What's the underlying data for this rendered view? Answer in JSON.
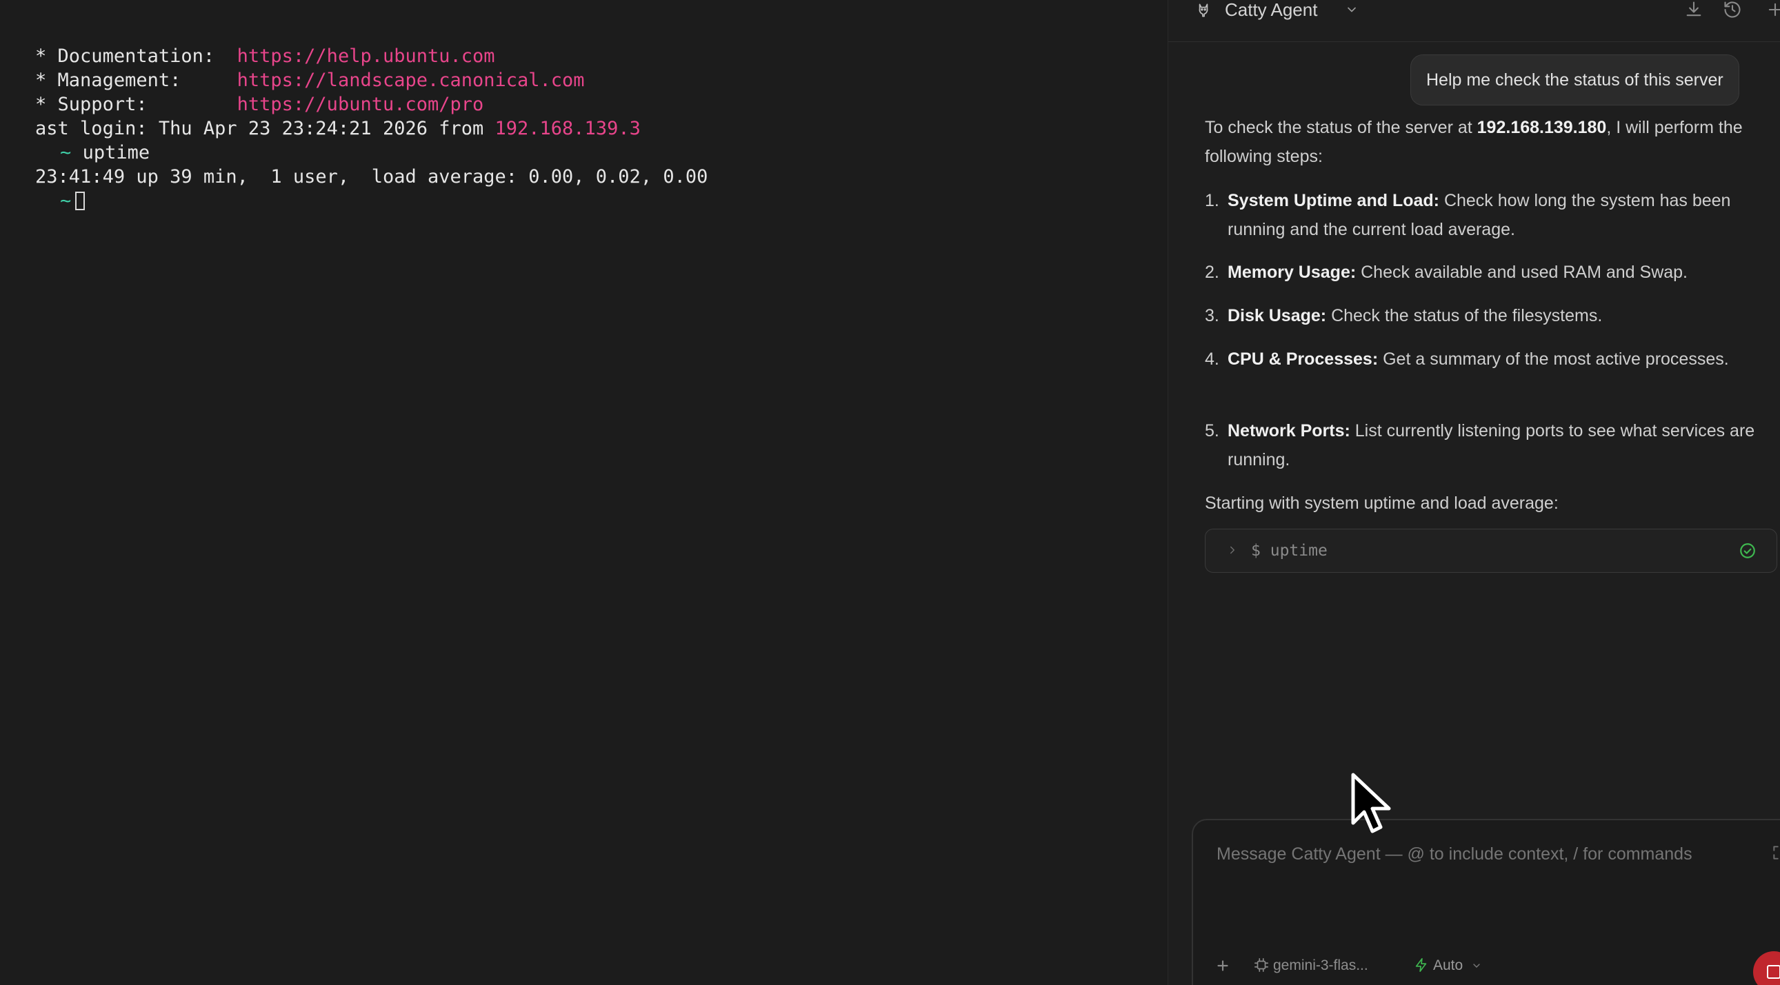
{
  "terminal": {
    "lines": [
      {
        "label": "* Documentation:  ",
        "url": "https://help.ubuntu.com"
      },
      {
        "label": "* Management:     ",
        "url": "https://landscape.canonical.com"
      },
      {
        "label": "* Support:        ",
        "url": "https://ubuntu.com/pro"
      }
    ],
    "last_login_text": "ast login: Thu Apr 23 23:24:21 2026 from ",
    "last_login_ip": "192.168.139.3",
    "prompt_symbol": "~",
    "command": "uptime",
    "output": "23:41:49 up 39 min,  1 user,  load average: 0.00, 0.02, 0.00"
  },
  "agent": {
    "title": "Catty Agent",
    "user_message": "Help me check the status of this server",
    "intro_before": "To check the status of the server at ",
    "intro_ip": "192.168.139.180",
    "intro_after": ", I will perform the following steps:",
    "steps": [
      {
        "num": "1.",
        "title": "System Uptime and Load:",
        "text": " Check how long the system has been running and the current load average."
      },
      {
        "num": "2.",
        "title": "Memory Usage:",
        "text": " Check available and used RAM and Swap."
      },
      {
        "num": "3.",
        "title": "Disk Usage:",
        "text": " Check the status of the filesystems."
      },
      {
        "num": "4.",
        "title": "CPU & Processes:",
        "text": " Get a summary of the most active processes."
      },
      {
        "num": "5.",
        "title": "Network Ports:",
        "text": " List currently listening ports to see what services are running."
      }
    ],
    "outro": "Starting with system uptime and load average:",
    "command_block": {
      "prompt": "$",
      "command": "uptime",
      "status": "success"
    },
    "composer": {
      "placeholder": "Message Catty Agent — @ to include context, / for commands",
      "model": "gemini-3-flas...",
      "mode": "Auto"
    },
    "colors": {
      "accent_green": "#3fb950",
      "stop_red": "#c0262d",
      "url_pink": "#e8458b"
    }
  }
}
